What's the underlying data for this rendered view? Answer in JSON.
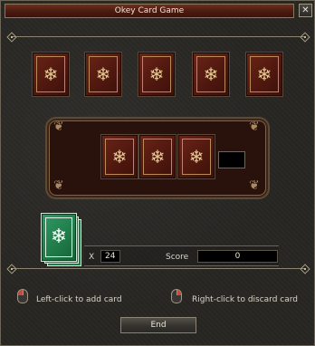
{
  "window": {
    "title": "Okey Card Game",
    "close_glyph": "✕"
  },
  "colors": {
    "card_back": "#5a1c12",
    "card_back_new": "#1f7a48",
    "frame_gold": "#b98a5a",
    "title_bar": "#4a1a10"
  },
  "draw_row": {
    "card_count": 5,
    "icon": "snowflake-icon"
  },
  "tray": {
    "card_count": 3
  },
  "deck": {
    "count_prefix": "X",
    "count": "24",
    "score_label": "Score",
    "score": "0"
  },
  "hints": {
    "left": "Left-click to add card",
    "right": "Right-click to discard card"
  },
  "actions": {
    "end_label": "End"
  }
}
